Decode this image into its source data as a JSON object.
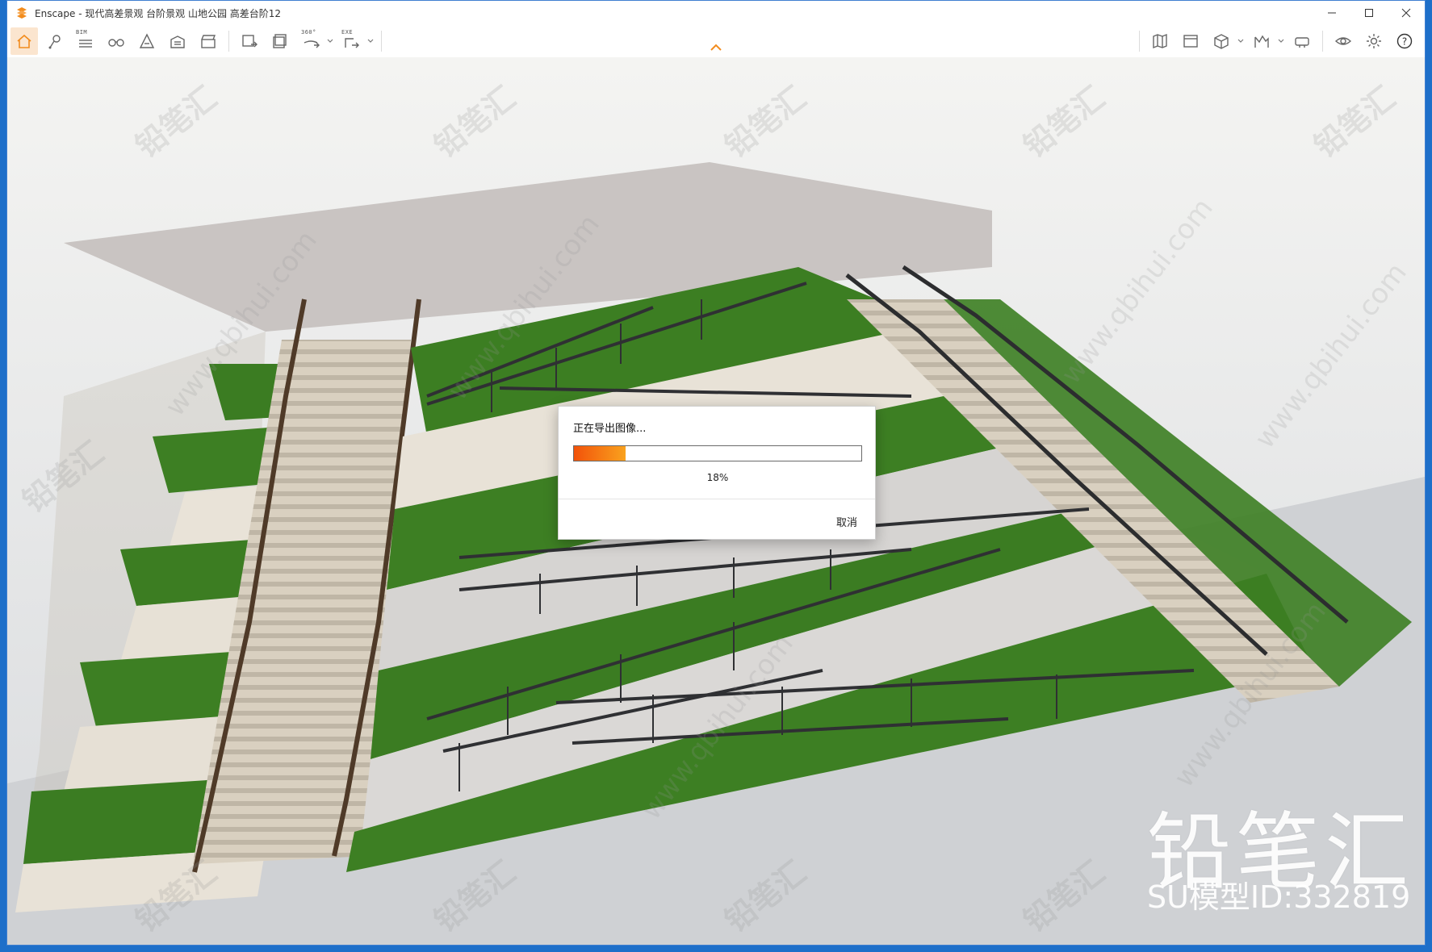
{
  "window": {
    "title": "Enscape - 现代高差景观 台阶景观 山地公园 高差台阶12",
    "controls": [
      "minimize-icon",
      "maximize-icon",
      "close-icon"
    ]
  },
  "toolbar": {
    "left_tools": [
      {
        "name": "home",
        "icon": "home-icon",
        "active": true
      },
      {
        "name": "location",
        "icon": "location-pin-icon"
      },
      {
        "name": "bim",
        "icon": "bim-list-icon",
        "label": "BIM"
      },
      {
        "name": "views",
        "icon": "binoculars-icon"
      },
      {
        "name": "atmosphere",
        "icon": "atmosphere-icon"
      },
      {
        "name": "assets",
        "icon": "building-icon"
      },
      {
        "name": "video",
        "icon": "clapperboard-icon"
      }
    ],
    "export_tools": [
      {
        "name": "screenshot",
        "icon": "screenshot-export-icon"
      },
      {
        "name": "batch-render",
        "icon": "batch-render-icon"
      },
      {
        "name": "panorama",
        "icon": "panorama-360-icon",
        "label": "360°"
      },
      {
        "name": "exe",
        "icon": "exe-export-icon",
        "label": "EXE"
      }
    ],
    "right_tools": [
      {
        "name": "map",
        "icon": "map-icon"
      },
      {
        "name": "window",
        "icon": "window-icon"
      },
      {
        "name": "cube",
        "icon": "cube-icon"
      },
      {
        "name": "chart",
        "icon": "chart-icon"
      },
      {
        "name": "vr",
        "icon": "vr-headset-icon"
      },
      {
        "name": "visual",
        "icon": "eye-icon"
      },
      {
        "name": "settings",
        "icon": "gear-icon"
      },
      {
        "name": "help",
        "icon": "help-icon"
      }
    ]
  },
  "dialog": {
    "title": "正在导出图像...",
    "progress_percent": 18,
    "progress_label": "18%",
    "cancel_label": "取消"
  },
  "watermark": {
    "brand": "铅笔汇",
    "model_id": "SU模型ID:332819",
    "tile_text": "铅笔汇",
    "url_text": "www.qbihui.com"
  },
  "colors": {
    "accent": "#f28c1e",
    "progress_start": "#f2520a",
    "progress_end": "#f9a21e",
    "grass": "#3d7f23",
    "wall": "#e8e2d8",
    "ground": "#dfe1e3"
  }
}
